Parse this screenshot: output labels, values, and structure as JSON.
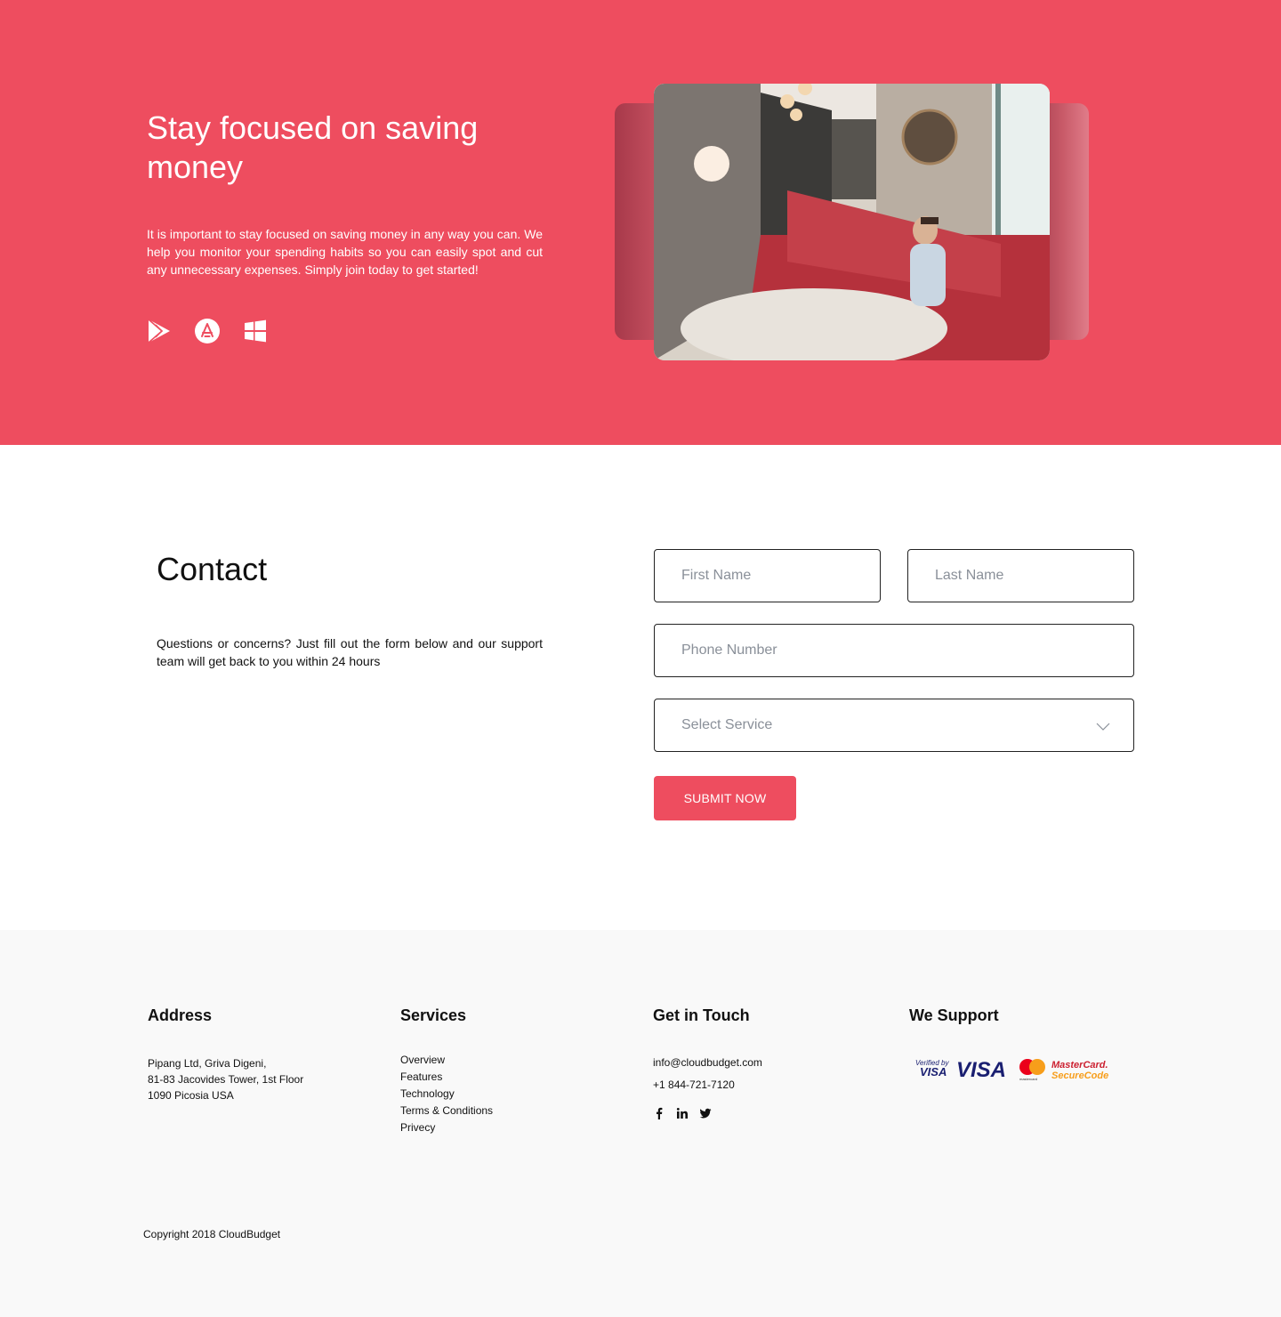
{
  "hero": {
    "title": "Stay focused on saving money",
    "text": "It is important to stay focused on saving money in any way you can. We help you monitor your spending habits so you can easily spot and cut any unnecessary expenses. Simply join today to get started!",
    "store_icons": [
      "google-play-icon",
      "app-store-icon",
      "windows-store-icon"
    ]
  },
  "contact": {
    "title": "Contact",
    "text": "Questions or concerns? Just fill out the form below and our support team will get back to you within 24 hours",
    "first_name_placeholder": "First Name",
    "last_name_placeholder": "Last Name",
    "phone_placeholder": "Phone Number",
    "service_value": "Select Service",
    "submit_label": "SUBMIT NOW"
  },
  "footer": {
    "address": {
      "heading": "Address",
      "lines": [
        "Pipang Ltd, Griva Digeni,",
        "81-83 Jacovides Tower, 1st Floor",
        "1090 Picosia USA"
      ]
    },
    "services": {
      "heading": "Services",
      "items": [
        "Overview",
        "Features",
        "Technology",
        "Terms & Conditions",
        "Privecy"
      ]
    },
    "get_in_touch": {
      "heading": "Get in Touch",
      "email": "info@cloudbudget.com",
      "phone": "+1 844-721-7120",
      "social_icons": [
        "facebook-icon",
        "linkedin-icon",
        "twitter-icon"
      ]
    },
    "we_support": {
      "heading": "We Support",
      "logos": [
        "Verified by",
        "VISA",
        "VISA",
        "MasterCard.",
        "SecureCode.",
        "mastercard"
      ]
    },
    "copyright": "Copyright 2018 CloudBudget"
  },
  "colors": {
    "accent": "#ee4d5f",
    "footer_bg": "#f9f9f9",
    "text": "#111111",
    "placeholder": "#8a9099"
  }
}
